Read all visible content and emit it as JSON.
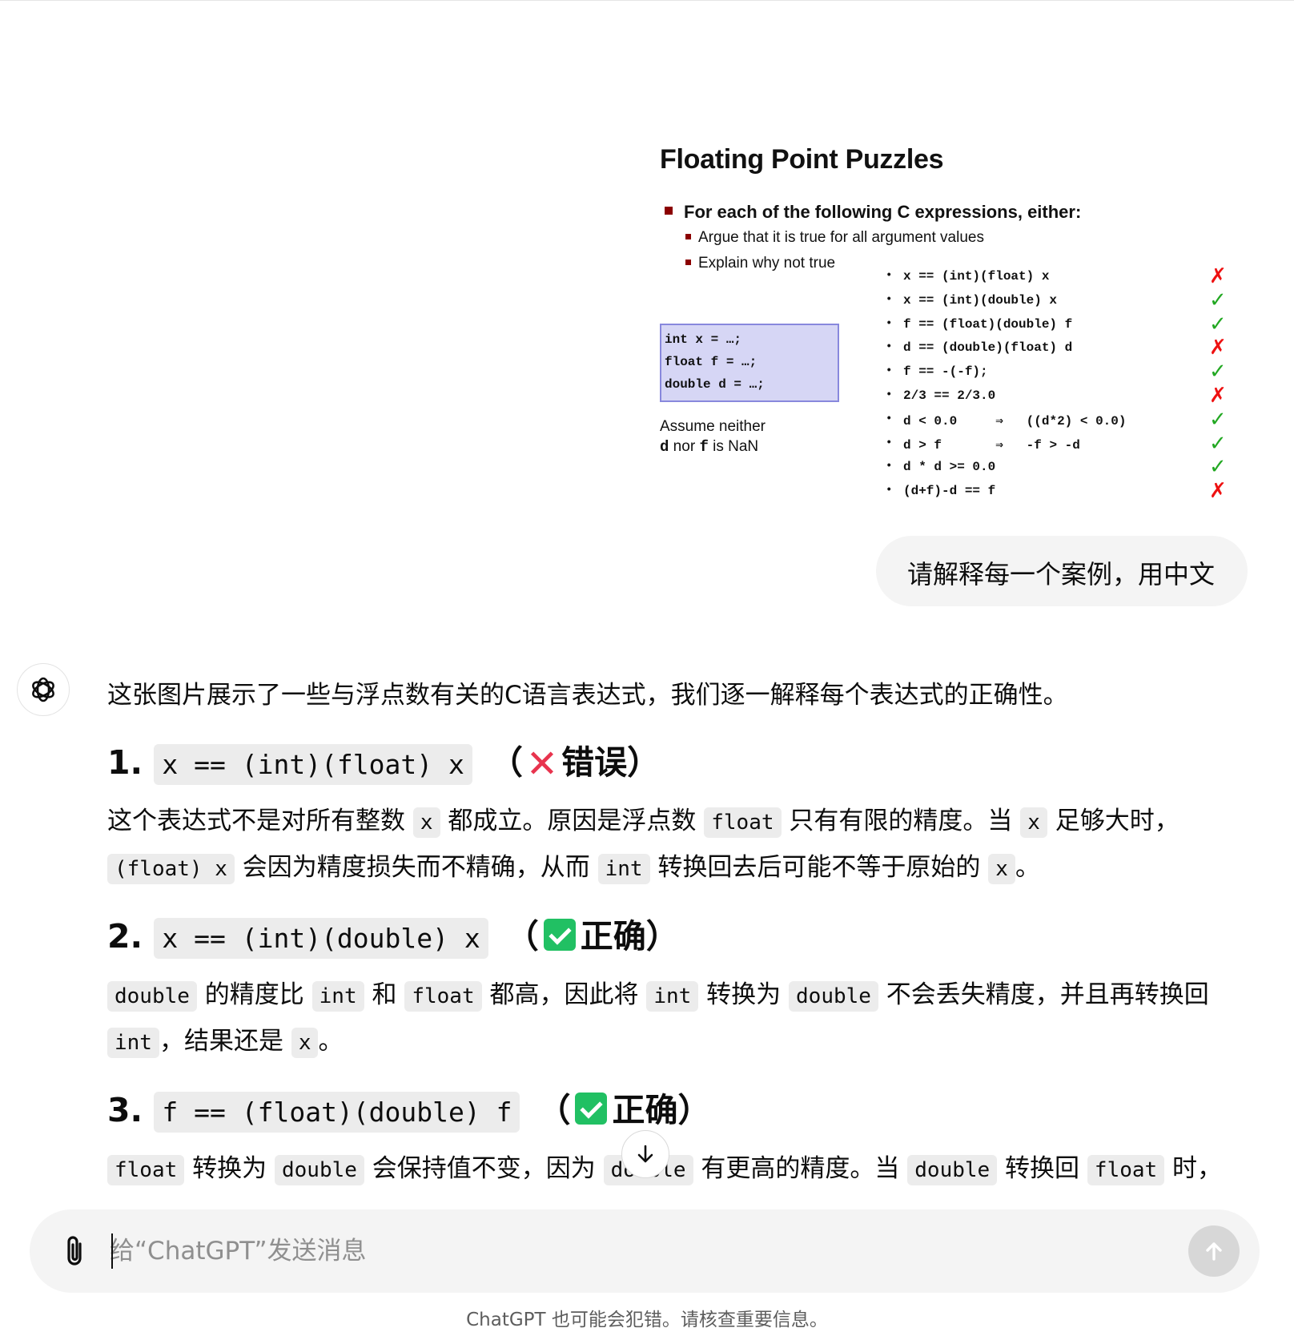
{
  "slide": {
    "title": "Floating Point Puzzles",
    "bullet_main": "For each of the following C expressions, either:",
    "bullet_sub": [
      "Argue that it is true for all argument values",
      "Explain why not true"
    ],
    "decls": [
      "int x = …;",
      "float f = …;",
      "double d = …;"
    ],
    "assume_line1": "Assume neither",
    "assume_d": "d",
    "assume_mid": " nor ",
    "assume_f": "f",
    "assume_end": " is NaN",
    "exprs": [
      {
        "text": "x == (int)(float) x",
        "mark": "✗",
        "ok": false
      },
      {
        "text": "x == (int)(double) x",
        "mark": "✓",
        "ok": true
      },
      {
        "text": "f == (float)(double) f",
        "mark": "✓",
        "ok": true
      },
      {
        "text": "d == (double)(float) d",
        "mark": "✗",
        "ok": false
      },
      {
        "text": "f == -(-f);",
        "mark": "✓",
        "ok": true
      },
      {
        "text": "2/3 == 2/3.0",
        "mark": "✗",
        "ok": false
      },
      {
        "text": "d < 0.0     ⇒   ((d*2) < 0.0)",
        "mark": "✓",
        "ok": true
      },
      {
        "text": "d > f       ⇒   -f > -d",
        "mark": "✓",
        "ok": true
      },
      {
        "text": "d * d >= 0.0",
        "mark": "✓",
        "ok": true
      },
      {
        "text": "(d+f)-d == f",
        "mark": "✗",
        "ok": false
      }
    ]
  },
  "user_message": "请解释每一个案例，用中文",
  "assistant": {
    "intro": "这张图片展示了一些与浮点数有关的C语言表达式，我们逐一解释每个表达式的正确性。",
    "items": [
      {
        "num": "1.",
        "expr": "x == (int)(float) x",
        "open": "（",
        "verdict_text": "错误）",
        "p1": [
          "这个表达式不是对所有整数 ",
          "x",
          " 都成立。原因是浮点数 ",
          "float",
          " 只有有限的精度。当 ",
          "x",
          " 足够大时，"
        ],
        "p2": [
          "(float) x",
          " 会因为精度损失而不精确，从而 ",
          "int",
          " 转换回去后可能不等于原始的 ",
          "x",
          "。"
        ]
      },
      {
        "num": "2.",
        "expr": "x == (int)(double) x",
        "open": "（",
        "verdict_text": "正确）",
        "p1": [
          "double",
          " 的精度比 ",
          "int",
          " 和 ",
          "float",
          " 都高，因此将 ",
          "int",
          " 转换为 ",
          "double",
          " 不会丢失精度，并且再转换回"
        ],
        "p2": [
          "int",
          "，结果还是 ",
          "x",
          "。"
        ]
      },
      {
        "num": "3.",
        "expr": "f == (float)(double) f",
        "open": "（",
        "verdict_text": "正确）",
        "p1": [
          "float",
          " 转换为 ",
          "double",
          " 会保持值不变，因为 ",
          "double",
          " 有更高的精度。当 ",
          "double",
          " 转换回 ",
          "float",
          " 时，"
        ]
      }
    ]
  },
  "composer": {
    "placeholder": "给“ChatGPT”发送消息"
  },
  "disclaimer": "ChatGPT 也可能会犯错。请核查重要信息。",
  "colors": {
    "ok": "#21c063",
    "bad": "#e8344e",
    "slide_ok": "#22a822",
    "slide_bad": "#ee1111"
  }
}
